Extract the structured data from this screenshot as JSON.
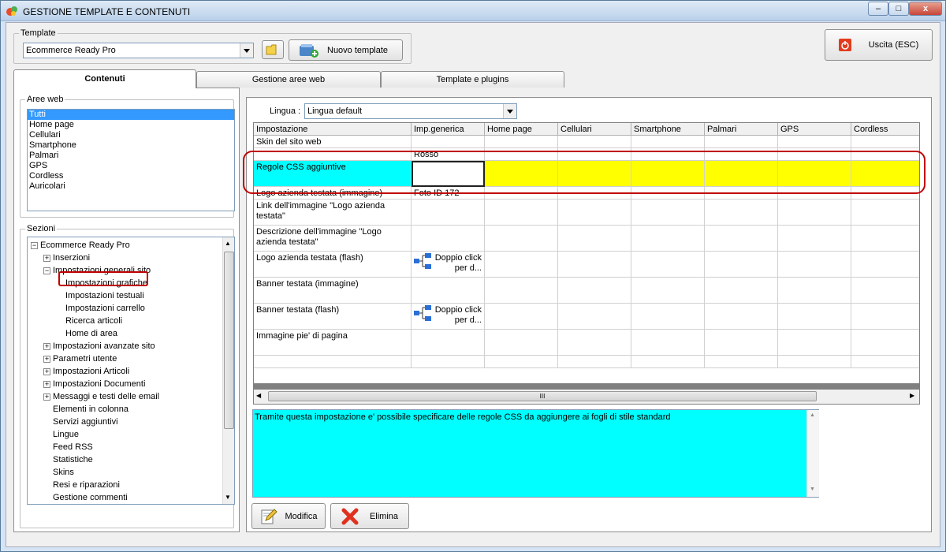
{
  "window": {
    "title": "GESTIONE TEMPLATE E CONTENUTI",
    "controls": {
      "minimize": "–",
      "maximize": "□",
      "close": "x"
    }
  },
  "template": {
    "legend": "Template",
    "selected": "Ecommerce Ready Pro",
    "new_label": "Nuovo template"
  },
  "exit_label": "Uscita (ESC)",
  "tabs": [
    "Contenuti",
    "Gestione aree web",
    "Template e plugins"
  ],
  "aree_web": {
    "legend": "Aree web",
    "items": [
      "Tutti",
      "Home page",
      "Cellulari",
      "Smartphone",
      "Palmari",
      "GPS",
      "Cordless",
      "Auricolari"
    ]
  },
  "sezioni": {
    "legend": "Sezioni",
    "nodes": [
      {
        "label": "Ecommerce Ready Pro",
        "level": 0,
        "expander": "−"
      },
      {
        "label": "Inserzioni",
        "level": 1,
        "expander": "+"
      },
      {
        "label": "Impostazioni generali sito",
        "level": 1,
        "expander": "−"
      },
      {
        "label": "Impostazioni grafiche",
        "level": 2,
        "expander": ""
      },
      {
        "label": "Impostazioni testuali",
        "level": 2,
        "expander": ""
      },
      {
        "label": "Impostazioni carrello",
        "level": 2,
        "expander": ""
      },
      {
        "label": "Ricerca articoli",
        "level": 2,
        "expander": ""
      },
      {
        "label": "Home di area",
        "level": 2,
        "expander": ""
      },
      {
        "label": "Impostazioni avanzate sito",
        "level": 1,
        "expander": "+"
      },
      {
        "label": "Parametri utente",
        "level": 1,
        "expander": "+"
      },
      {
        "label": "Impostazioni Articoli",
        "level": 1,
        "expander": "+"
      },
      {
        "label": "Impostazioni Documenti",
        "level": 1,
        "expander": "+"
      },
      {
        "label": "Messaggi e testi delle email",
        "level": 1,
        "expander": "+"
      },
      {
        "label": "Elementi in colonna",
        "level": 1,
        "expander": ""
      },
      {
        "label": "Servizi aggiuntivi",
        "level": 1,
        "expander": ""
      },
      {
        "label": "Lingue",
        "level": 1,
        "expander": ""
      },
      {
        "label": "Feed RSS",
        "level": 1,
        "expander": ""
      },
      {
        "label": "Statistiche",
        "level": 1,
        "expander": ""
      },
      {
        "label": "Skins",
        "level": 1,
        "expander": ""
      },
      {
        "label": "Resi e riparazioni",
        "level": 1,
        "expander": ""
      },
      {
        "label": "Gestione commenti",
        "level": 1,
        "expander": ""
      }
    ]
  },
  "lingua": {
    "label": "Lingua :",
    "selected": "Lingua default"
  },
  "grid": {
    "columns": [
      "Impostazione",
      "Imp.generica",
      "Home page",
      "Cellulari",
      "Smartphone",
      "Palmari",
      "GPS",
      "Cordless"
    ],
    "rows": [
      {
        "name": "Skin del sito web",
        "value": ""
      },
      {
        "name": "",
        "value": "Rosso"
      },
      {
        "name": "Regole CSS aggiuntive",
        "value": ""
      },
      {
        "name": "Logo azienda testata (immagine)",
        "value": "Foto ID 172"
      },
      {
        "name": "Link dell'immagine \"Logo azienda testata\"",
        "value": ""
      },
      {
        "name": "Descrizione dell'immagine \"Logo azienda testata\"",
        "value": ""
      },
      {
        "name": "Logo azienda testata (flash)",
        "value": "Doppio click per d..."
      },
      {
        "name": "Banner testata (immagine)",
        "value": ""
      },
      {
        "name": "Banner testata (flash)",
        "value": "Doppio click per d..."
      },
      {
        "name": "Immagine pie' di pagina",
        "value": ""
      }
    ],
    "scroll_grip": "III"
  },
  "description": "Tramite questa impostazione e' possibile specificare delle regole CSS da aggiungere ai fogli di stile standard",
  "modifica_label": "Modifica",
  "elimina_label": "Elimina",
  "colors": {
    "cyan": "#00ffff",
    "yellow": "#ffff00",
    "highlight": "#c00000"
  }
}
